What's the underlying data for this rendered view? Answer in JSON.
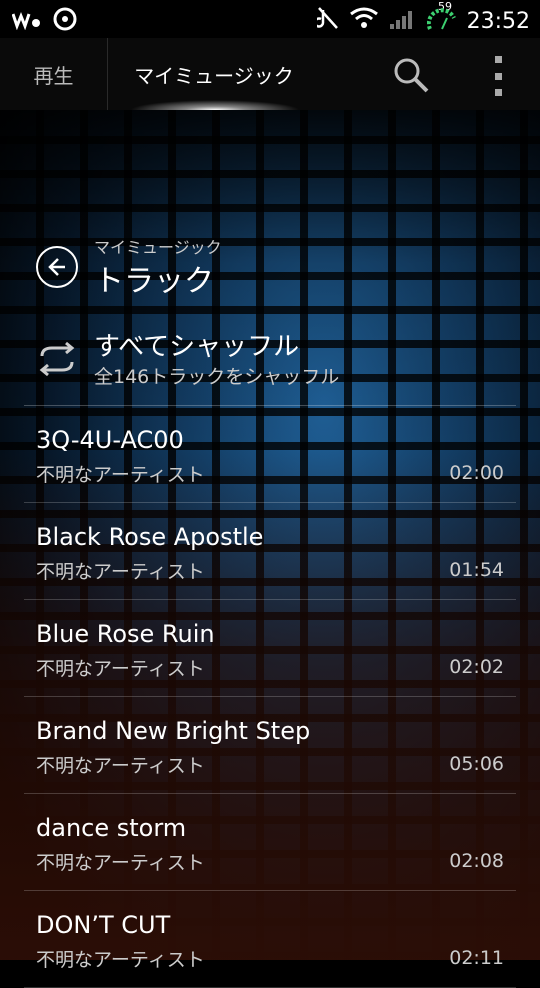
{
  "status_bar": {
    "time": "23:52",
    "battery_percent": "59",
    "icons": [
      "walkman-icon",
      "sync-icon",
      "mute-icon",
      "wifi-icon",
      "signal-icon",
      "battery-icon"
    ]
  },
  "action_bar": {
    "tab_play": "再生",
    "tab_my_music": "マイミュージック"
  },
  "header": {
    "breadcrumb": "マイミュージック",
    "title": "トラック"
  },
  "shuffle": {
    "title": "すべてシャッフル",
    "subtitle": "全146トラックをシャッフル"
  },
  "tracks": [
    {
      "name": "3Q-4U-AC00",
      "artist": "不明なアーティスト",
      "duration": "02:00"
    },
    {
      "name": "Black Rose Apostle",
      "artist": "不明なアーティスト",
      "duration": "01:54"
    },
    {
      "name": "Blue Rose Ruin",
      "artist": "不明なアーティスト",
      "duration": "02:02"
    },
    {
      "name": "Brand New Bright Step",
      "artist": "不明なアーティスト",
      "duration": "05:06"
    },
    {
      "name": "dance storm",
      "artist": "不明なアーティスト",
      "duration": "02:08"
    },
    {
      "name": "DON’T CUT",
      "artist": "不明なアーティスト",
      "duration": "02:11"
    }
  ],
  "colors": {
    "accent_green": "#3cd070",
    "tab_glow": "#ffffff"
  }
}
